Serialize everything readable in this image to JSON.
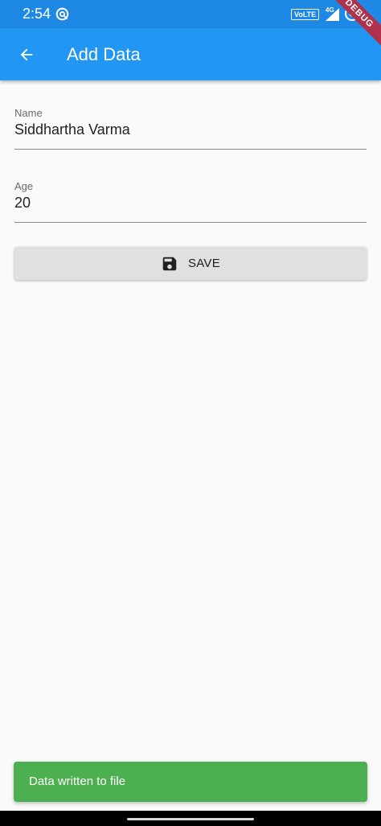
{
  "status_bar": {
    "time": "2:54",
    "volte": "VoLTE",
    "network": "4G",
    "app_icon": "at-sign-icon",
    "signal_icon": "signal-icon",
    "battery_icon": "battery-icon"
  },
  "debug_banner": "DEBUG",
  "app_bar": {
    "title": "Add Data",
    "back_icon": "arrow-back-icon",
    "color": "#2196f3"
  },
  "form": {
    "name": {
      "label": "Name",
      "value": "Siddhartha Varma"
    },
    "age": {
      "label": "Age",
      "value": "20"
    }
  },
  "save_button": {
    "label": "SAVE",
    "icon": "save-icon"
  },
  "snackbar": {
    "message": "Data written to file",
    "color": "#4caf50"
  }
}
